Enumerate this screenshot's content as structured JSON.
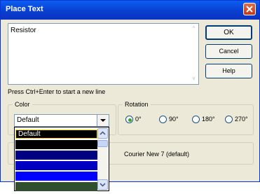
{
  "window": {
    "title": "Place Text"
  },
  "text_field": {
    "value": "Resistor"
  },
  "buttons": {
    "ok": "OK",
    "cancel": "Cancel",
    "help": "Help"
  },
  "hint": "Press Ctrl+Enter to start a new line",
  "color": {
    "label": "Color",
    "selected": "Default",
    "options": [
      {
        "label": "Default",
        "color": "#000000"
      },
      {
        "label": "",
        "color": "#000000"
      },
      {
        "label": "",
        "color": "#000080"
      },
      {
        "label": "",
        "color": "#0000c0"
      },
      {
        "label": "",
        "color": "#0000ff"
      },
      {
        "label": "",
        "color": "#2f4f2f"
      }
    ]
  },
  "rotation": {
    "label": "Rotation",
    "options": [
      "0°",
      "90°",
      "180°",
      "270°"
    ],
    "selected": "0°"
  },
  "font": {
    "label": "Courier New 7 (default)"
  },
  "colors": {
    "title_bar": "#0a5ff1",
    "close_button": "#d04a2a",
    "radio_selected": "#2fa82f"
  }
}
